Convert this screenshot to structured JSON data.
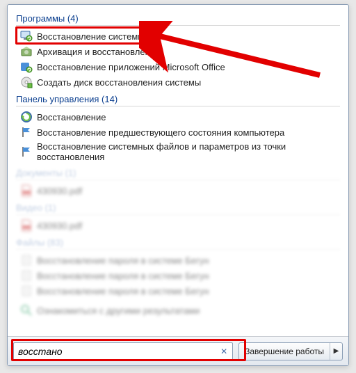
{
  "sections": {
    "programs": {
      "title": "Программы (4)"
    },
    "control_panel": {
      "title": "Панель управления (14)"
    },
    "documents": {
      "title": "Документы (1)"
    },
    "video": {
      "title": "Видео (1)"
    },
    "files": {
      "title": "Файлы (83)"
    }
  },
  "programs": [
    {
      "label": "Восстановление системы"
    },
    {
      "label": "Архивация и восстановление"
    },
    {
      "label": "Восстановление приложений Microsoft Office"
    },
    {
      "label": "Создать диск восстановления системы"
    }
  ],
  "control_panel": [
    {
      "label": "Восстановление"
    },
    {
      "label": "Восстановление предшествующего состояния компьютера"
    },
    {
      "label": "Восстановление системных файлов и параметров из точки восстановления"
    }
  ],
  "documents": [
    {
      "label": "430930.pdf"
    }
  ],
  "video": [
    {
      "label": "430930.pdf"
    }
  ],
  "files": [
    {
      "label": "Восстановление пароля в системе Бегун"
    },
    {
      "label": "Восстановление пароля в системе Бегун"
    },
    {
      "label": "Восстановление пароля в системе Бегун"
    }
  ],
  "more_results": "Ознакомиться с другими результатами",
  "search": {
    "value": "восстано"
  },
  "shutdown": {
    "label": "Завершение работы"
  },
  "colors": {
    "accent": "#0a3e8f",
    "annotation": "#e20000"
  }
}
